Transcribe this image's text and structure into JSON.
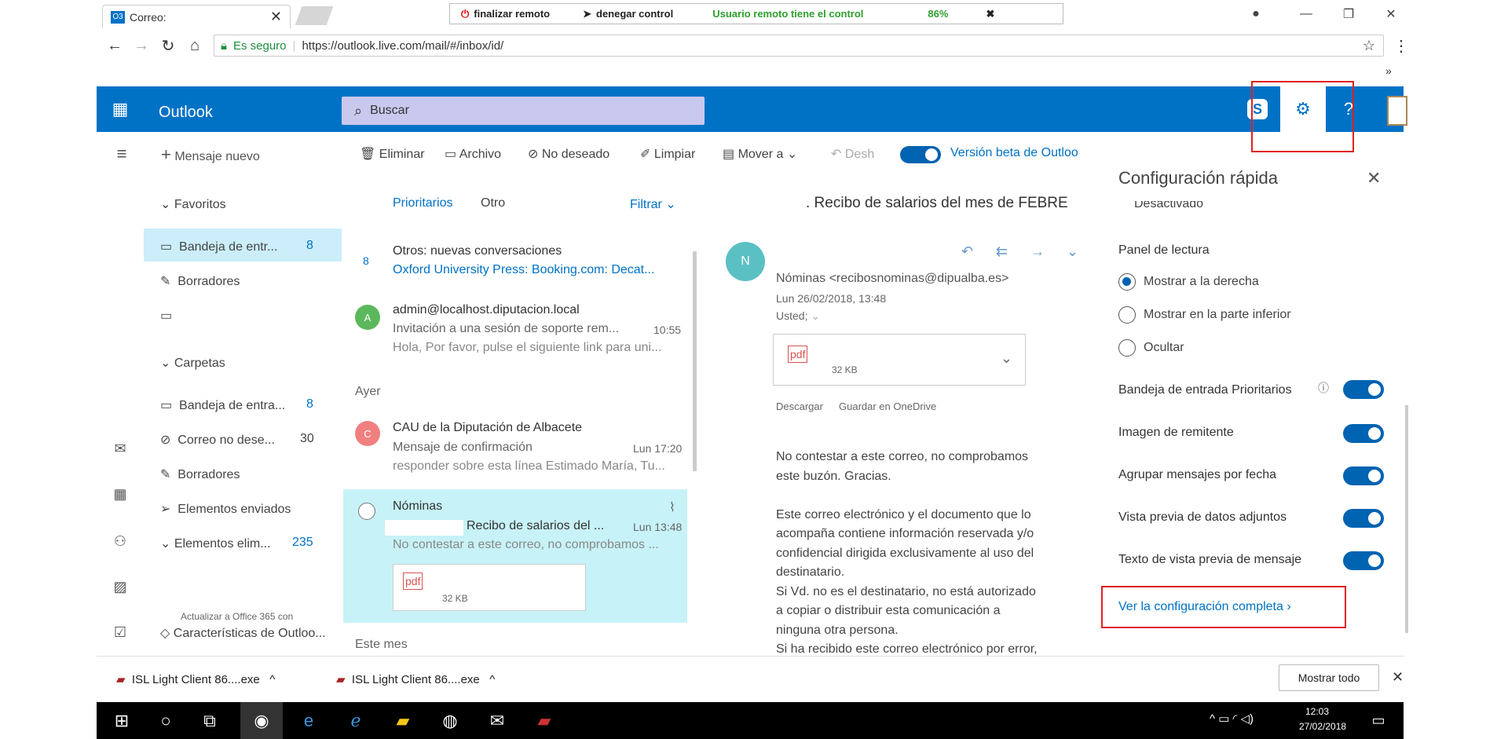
{
  "browser": {
    "tab_title": "Correo:",
    "tab_icon": "O3",
    "url_secure": "Es seguro",
    "url": "https://outlook.live.com/mail/#/inbox/id/",
    "overflow": "»"
  },
  "remote": {
    "end": "finalizar remoto",
    "deny": "denegar control",
    "status": "Usuario remoto tiene el control",
    "percent": "86%",
    "status_color": "#2ca02c"
  },
  "outlook": {
    "brand": "Outlook",
    "search_placeholder": "Buscar",
    "accent": "#0072c6"
  },
  "toolbar": {
    "new_message": "Mensaje nuevo",
    "delete": "Eliminar",
    "archive": "Archivo",
    "junk": "No deseado",
    "sweep": "Limpiar",
    "move": "Mover a",
    "undo": "Desh",
    "beta": "Versión beta de Outloo"
  },
  "nav": {
    "favorites": "Favoritos",
    "fav_items": [
      {
        "label": "Bandeja de entr...",
        "count": "8"
      },
      {
        "label": "Borradores",
        "count": ""
      }
    ],
    "folders": "Carpetas",
    "folder_items": [
      {
        "label": "Bandeja de entra...",
        "count": "8"
      },
      {
        "label": "Correo no dese...",
        "count": "30"
      },
      {
        "label": "Borradores",
        "count": ""
      },
      {
        "label": "Elementos enviados",
        "count": ""
      },
      {
        "label": "Elementos elim...",
        "count": "235"
      }
    ],
    "upgrade_line1": "Actualizar a Office 365 con",
    "upgrade_line2": "Características de Outloo..."
  },
  "list": {
    "tab_focused": "Prioritarios",
    "tab_other": "Otro",
    "filter": "Filtrar",
    "others_count": "8",
    "others_title": "Otros: nuevas conversaciones",
    "others_sub": "Oxford University Press: Booking.com: Decat...",
    "group_yesterday": "Ayer",
    "group_month": "Este mes",
    "messages": [
      {
        "avatar": "A",
        "avatar_color": "#5cb85c",
        "from": "admin@localhost.diputacion.local",
        "subject": "Invitación a una sesión de soporte rem...",
        "time": "10:55",
        "preview": "Hola, Por favor, pulse el siguiente link para uni..."
      },
      {
        "avatar": "C",
        "avatar_color": "#f08080",
        "from": "CAU de la Diputación de Albacete",
        "subject": "Mensaje de confirmación",
        "time": "Lun 17:20",
        "preview": "responder sobre esta línea Estimado María, Tu..."
      },
      {
        "avatar": "",
        "avatar_color": "",
        "from": "Nóminas",
        "subject": "Recibo de salarios del ...",
        "time": "Lun 13:48",
        "preview": "No contestar a este correo, no comprobamos ...",
        "attach_size": "32 KB"
      }
    ]
  },
  "reading": {
    "subject": ". Recibo de salarios del mes de FEBRE",
    "avatar": "N",
    "avatar_color": "#5bc0c4",
    "from": "Nóminas <recibosnominas@dipualba.es>",
    "date": "Lun 26/02/2018, 13:48",
    "to": "Usted;",
    "attach_size": "32 KB",
    "download": "Descargar",
    "save_onedrive": "Guardar en OneDrive",
    "body": [
      "No contestar a este correo, no comprobamos",
      "este buzón. Gracias.",
      "",
      "Este correo electrónico y el documento que lo",
      "acompaña contiene información reservada y/o",
      "confidencial dirigida exclusivamente al uso del",
      "destinatario.",
      "Si Vd. no es el destinatario, no está autorizado",
      "a copiar o distribuir esta comunicación a",
      "ninguna otra persona.",
      "Si ha recibido este correo electrónico por error,"
    ]
  },
  "settings": {
    "title": "Configuración rápida",
    "cut_option": "Desactivado",
    "reading_pane": "Panel de lectura",
    "radio": [
      {
        "label": "Mostrar a la derecha",
        "on": true
      },
      {
        "label": "Mostrar en la parte inferior",
        "on": false
      },
      {
        "label": "Ocultar",
        "on": false
      }
    ],
    "toggles": [
      "Bandeja de entrada Prioritarios",
      "Imagen de remitente",
      "Agrupar mensajes por fecha",
      "Vista previa de datos adjuntos",
      "Texto de vista previa de mensaje"
    ],
    "full_link": "Ver la configuración completa"
  },
  "downloads": {
    "items": [
      "ISL Light Client 86....exe",
      "ISL Light Client 86....exe"
    ],
    "show_all": "Mostrar todo"
  },
  "taskbar": {
    "time": "12:03",
    "date": "27/02/2018"
  }
}
